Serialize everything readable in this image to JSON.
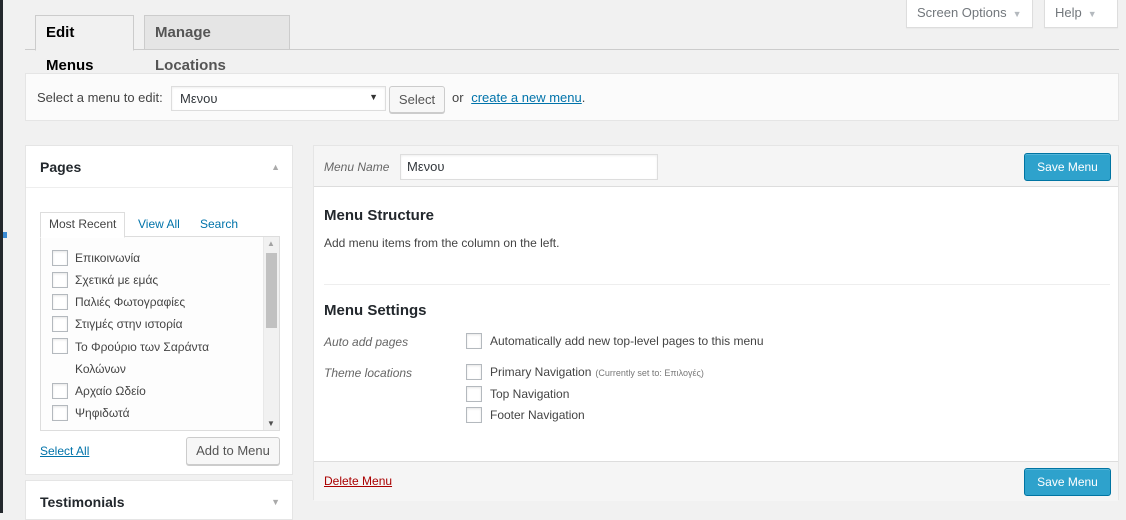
{
  "header": {
    "screen_options_label": "Screen Options",
    "help_label": "Help",
    "tabs": [
      {
        "label": "Edit Menus",
        "active": true
      },
      {
        "label": "Manage Locations",
        "active": false
      }
    ]
  },
  "select_bar": {
    "label": "Select a menu to edit:",
    "selected_menu": "Μενου",
    "select_button": "Select",
    "or_text": "or",
    "create_link": "create a new menu",
    "trailing": "."
  },
  "pages_panel": {
    "title": "Pages",
    "tabs": {
      "most_recent": "Most Recent",
      "view_all": "View All",
      "search": "Search"
    },
    "items": [
      {
        "label": "Επικοινωνία",
        "checked": false
      },
      {
        "label": "Σχετικά με εμάς",
        "checked": false
      },
      {
        "label": "Παλιές Φωτογραφίες",
        "checked": false
      },
      {
        "label": "Στιγμές στην ιστορία",
        "checked": false
      },
      {
        "label": "Το Φρούριο των Σαράντα Κολώνων",
        "checked": false
      },
      {
        "label": "Αρχαίο Ωδείο",
        "checked": false
      },
      {
        "label": "Ψηφιδωτά",
        "checked": false
      }
    ],
    "select_all": "Select All",
    "add_button": "Add to Menu"
  },
  "testimonials_panel": {
    "title": "Testimonials"
  },
  "editor": {
    "menu_name_label": "Menu Name",
    "menu_name_value": "Μενου",
    "save_button": "Save Menu",
    "structure_title": "Menu Structure",
    "structure_desc": "Add menu items from the column on the left.",
    "settings_title": "Menu Settings",
    "auto_add_label": "Auto add pages",
    "auto_add_option": "Automatically add new top-level pages to this menu",
    "theme_locations_label": "Theme locations",
    "locations": [
      {
        "label": "Primary Navigation",
        "note": "(Currently set to: Επιλογές)",
        "checked": false
      },
      {
        "label": "Top Navigation",
        "note": "",
        "checked": false
      },
      {
        "label": "Footer Navigation",
        "note": "",
        "checked": false
      }
    ],
    "delete_link": "Delete Menu"
  },
  "colors": {
    "primary_button": "#2ea2cc",
    "link": "#0073aa",
    "delete_link": "#aa0000",
    "background": "#f1f1f1"
  }
}
